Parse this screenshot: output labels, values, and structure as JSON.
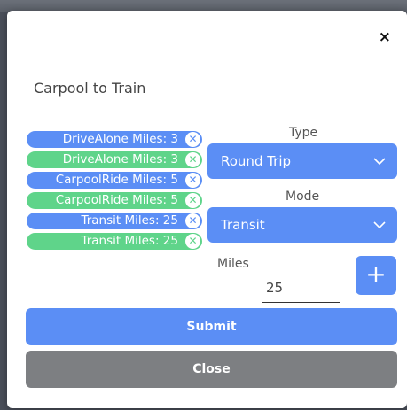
{
  "dialog": {
    "close_icon": "×",
    "title_value": "Carpool to Train"
  },
  "chips": [
    {
      "label": "DriveAlone Miles: 3",
      "color": "blue"
    },
    {
      "label": "DriveAlone Miles: 3",
      "color": "green"
    },
    {
      "label": "CarpoolRide Miles: 5",
      "color": "blue"
    },
    {
      "label": "CarpoolRide Miles: 5",
      "color": "green"
    },
    {
      "label": "Transit Miles: 25",
      "color": "blue"
    },
    {
      "label": "Transit Miles: 25",
      "color": "green"
    }
  ],
  "chip_remove_icon": "✕",
  "type": {
    "label": "Type",
    "value": "Round Trip"
  },
  "mode": {
    "label": "Mode",
    "value": "Transit"
  },
  "miles": {
    "label": "Miles",
    "value": "25"
  },
  "add_icon": "+",
  "buttons": {
    "submit": "Submit",
    "close": "Close"
  },
  "colors": {
    "accent_blue": "#5b8ef5",
    "accent_green": "#5fd48a",
    "close_gray": "#7d7f82"
  }
}
